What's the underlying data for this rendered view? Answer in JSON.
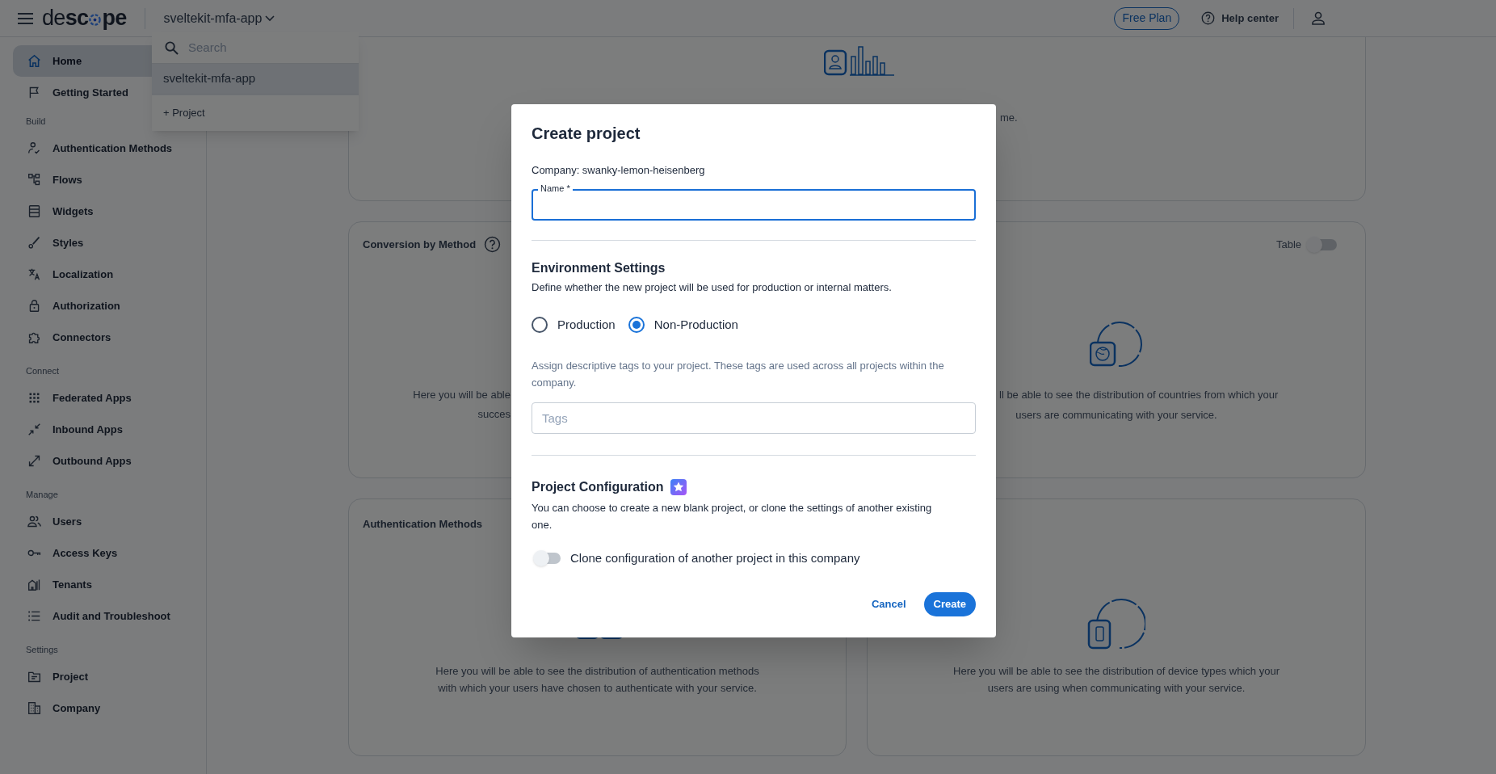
{
  "header": {
    "logo_start": "de**sc**",
    "logo_end": "pe",
    "project": "sveltekit-mfa-app",
    "plan": "Free Plan",
    "help": "Help center"
  },
  "project_menu": {
    "search_placeholder": "Search",
    "items": [
      {
        "label": "sveltekit-mfa-app",
        "selected": true
      }
    ],
    "add": "+ Project"
  },
  "sidebar": {
    "sections": [
      {
        "items": [
          {
            "label": "Home",
            "selected": true
          },
          {
            "label": "Getting Started",
            "selected": false
          }
        ]
      },
      {
        "title": "Build",
        "items": [
          {
            "label": "Authentication Methods",
            "selected": false
          },
          {
            "label": "Flows",
            "selected": false
          },
          {
            "label": "Widgets",
            "selected": false
          },
          {
            "label": "Styles",
            "selected": false
          },
          {
            "label": "Localization",
            "selected": false
          },
          {
            "label": "Authorization",
            "selected": false
          },
          {
            "label": "Connectors",
            "selected": false
          }
        ]
      },
      {
        "title": "Connect",
        "items": [
          {
            "label": "Federated Apps",
            "selected": false
          },
          {
            "label": "Inbound Apps",
            "selected": false
          },
          {
            "label": "Outbound Apps",
            "selected": false
          }
        ]
      },
      {
        "title": "Manage",
        "items": [
          {
            "label": "Users",
            "selected": false
          },
          {
            "label": "Access Keys",
            "selected": false
          },
          {
            "label": "Tenants",
            "selected": false
          },
          {
            "label": "Audit and Troubleshoot",
            "selected": false
          }
        ]
      },
      {
        "title": "Settings",
        "items": [
          {
            "label": "Project",
            "selected": false
          },
          {
            "label": "Company",
            "selected": false
          }
        ]
      }
    ]
  },
  "dashboard": {
    "top_card": {
      "text_fragment": "me."
    },
    "conversion_card": {
      "title": "Conversion by Method",
      "text_fragments": [
        "Here you will be able",
        "succes"
      ]
    },
    "countries_card": {
      "toggle": {
        "label": "Table",
        "on": false
      },
      "text_fragment": "ll be able to see the distribution of countries from which your",
      "text_line": "users are communicating with your service."
    },
    "auth_methods_card": {
      "title": "Authentication Methods",
      "text": [
        "Here you will be able to see the distribution of authentication methods",
        "with which your users have chosen to authenticate with your service."
      ]
    },
    "devices_card": {
      "text": [
        "Here you will be able to see the distribution of device types which your",
        "users are using when communicating with your service."
      ]
    }
  },
  "dialog": {
    "title": "Create project",
    "company": "Company: swanky-lemon-heisenberg",
    "name_field": {
      "label": "Name *",
      "focused": true
    },
    "environment": {
      "title": "Environment Settings",
      "description": "Define whether the new project will be used for production or internal matters.",
      "options": [
        {
          "label": "Production",
          "selected": false
        },
        {
          "label": "Non-Production",
          "selected": true
        }
      ]
    },
    "tags_help": "Assign descriptive tags to your project. These tags are used across all projects within the company.",
    "tags_field": {
      "placeholder": "Tags"
    },
    "configuration": {
      "title": "Project Configuration",
      "description": "You can choose to create a new blank project, or clone the settings of another existing one.",
      "clone_toggle": {
        "label": "Clone configuration of another project in this company",
        "on": false
      }
    },
    "buttons": {
      "cancel": "Cancel",
      "create": "Create"
    }
  }
}
